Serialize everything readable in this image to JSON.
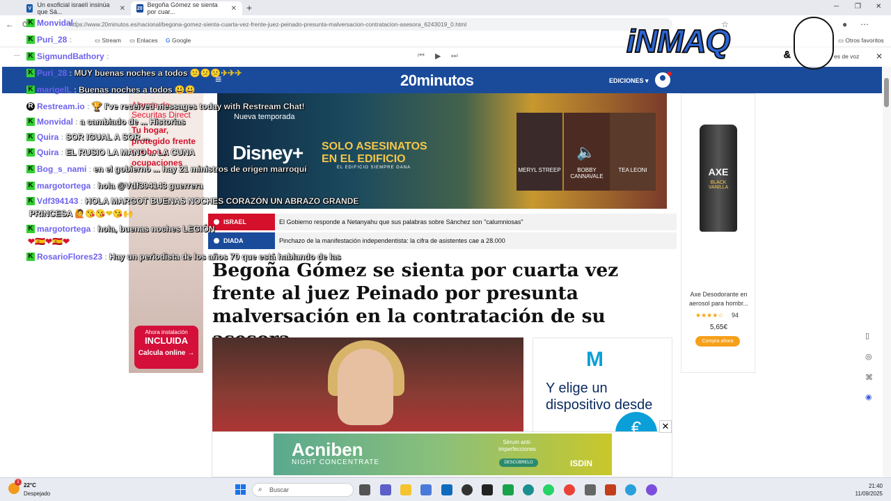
{
  "browser": {
    "tabs": [
      {
        "title": "Un exoficial israelí insinúa que Sá...",
        "favicon": "V"
      },
      {
        "title": "Begoña Gómez se sienta por cuar...",
        "favicon": "20"
      }
    ],
    "new_tab": "+",
    "url": "https://www.20minutos.es/nacional/begona-gomez-sienta-cuarta-vez-frente-juez-peinado-presunta-malversacion-contratacion-asesora_6243019_0.html",
    "bookmarks": [
      "Stream",
      "Enlaces",
      "Google"
    ],
    "bookmarks_right": "Otros favoritos",
    "media_right": "es de voz"
  },
  "site": {
    "logo": "20minutos",
    "editions_label": "EDICIONES ▾",
    "brand_color": "#1a4b9b"
  },
  "left_ad": {
    "heading": "Alarma de Securitas Direct",
    "tagline": "Tu hogar, protegido frente a robos y ocupaciones",
    "pill_top": "Ahora instalación",
    "pill_main": "INCLUIDA",
    "cta": "Calcula online →"
  },
  "hero_ad": {
    "subtitle": "Nueva temporada",
    "brand": "Disney+",
    "show": "SOLO ASESINATOS EN EL EDIFICIO",
    "show_sub": "EL EDIFICIO SIEMPRE GANA",
    "cast": [
      "MERYL STREEP",
      "BOBBY CANNAVALE",
      "TEA LEONI"
    ]
  },
  "right_ad": {
    "brand": "AXE",
    "variant": "BLACK VANILLA",
    "product": "Axe Desodorante en aerosol para hombr...",
    "stars": "★★★★☆",
    "rating_count": "94",
    "price": "5,65€",
    "cta": "Compra ahora"
  },
  "tickers": [
    {
      "tag": "ISRAEL",
      "text": "El Gobierno responde a Netanyahu que sus palabras sobre Sánchez son \"calumniosas\"",
      "color": "#d4102a"
    },
    {
      "tag": "DIADA",
      "text": "Pinchazo de la manifestación independentista: la cifra de asistentes cae a 28.000",
      "color": "#1a4b9b"
    }
  ],
  "headline": "Begoña Gómez se sienta por cuarta vez frente al juez Peinado por presunta malversación en la contratación de su asesora",
  "movistar_ad": {
    "text": "Y elige un dispositivo desde",
    "currency": "€"
  },
  "bottom_ad": {
    "brand": "Acniben",
    "line": "NIGHT CONCENTRATE",
    "claim": "Sérum anti-imperfecciones",
    "cta": "DESCÚBRELO",
    "maker": "ISDIN"
  },
  "chat": [
    {
      "user": "Monvidal",
      "text": "",
      "badge": "K"
    },
    {
      "user": "Puri_28",
      "text": "",
      "badge": "K"
    },
    {
      "user": "SigmundBathory",
      "text": "",
      "badge": "K"
    },
    {
      "user": "Puri_28",
      "text": "MUY buenas noches a todos",
      "badge": "K",
      "emoji": "😕😕😕✈✈✈"
    },
    {
      "user": "marigelL",
      "text": "Buenas noches a todos",
      "badge": "K",
      "emoji": "😃😃"
    },
    {
      "user": "Restream.io",
      "text": "🏆 I've received messages today with Restream Chat!",
      "badge": "R"
    },
    {
      "user": "Monvidal",
      "text": "a cambiado de ...  Historias",
      "badge": "K"
    },
    {
      "user": "Quira",
      "text": "SOR IGUAL A SOR ...",
      "badge": "K"
    },
    {
      "user": "Quira",
      "text": "EL RUSIO LA MANO ... LA CUNA",
      "badge": "K"
    },
    {
      "user": "Bog_s_nami",
      "text": "en el gobierno ... hay 21 ministros de origen marroquí",
      "badge": "K"
    },
    {
      "user": "margotortega",
      "text": "hola @Vdf394143 guerrera",
      "badge": "K"
    },
    {
      "user": "Vdf394143",
      "text": "HOLA MARGOT BUENAS NOCHES CORAZÓN UN ABRAZO GRANDE",
      "badge": "K"
    },
    {
      "user": "",
      "text": "PRINCESA",
      "badge": "",
      "emoji": "🙋😘😘❤😘🙌"
    },
    {
      "user": "margotortega",
      "text": "hola, buenas noches LEGIÓN",
      "badge": "K",
      "emoji": "❤🇪🇸❤🇪🇸❤🇪🇸❤🇪🇸"
    },
    {
      "user": "",
      "text": "",
      "badge": "",
      "emoji": "❤🇪🇸❤🇪🇸❤"
    },
    {
      "user": "RosarioFlores23",
      "text": "Hay un periodista de los años 70 que está hablando de las",
      "badge": "K"
    }
  ],
  "overlay_logo": {
    "text": "iNMAQ",
    "amp": "&"
  },
  "taskbar": {
    "temp": "22°C",
    "weather": "Despejado",
    "weather_badge": "1",
    "search_placeholder": "Buscar",
    "time": "21:40",
    "date": "11/09/2025"
  }
}
